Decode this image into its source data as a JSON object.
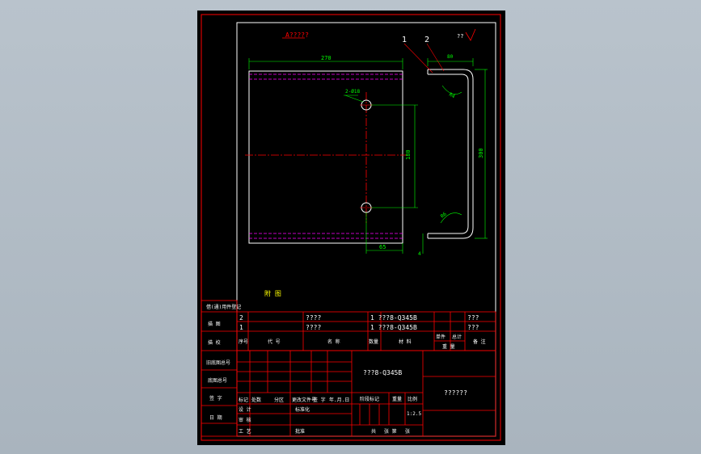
{
  "colors": {
    "background": "#b3bec8",
    "sheet": "#000000",
    "frame": "#ff0000",
    "line": "#ffffff",
    "dimension": "#00ff00",
    "center": "#ff0000",
    "hidden": "#ff00ff",
    "text_yellow": "#ffff00"
  },
  "drawing": {
    "view_label": "A?????",
    "roughness": "??",
    "balloon_1": "1",
    "balloon_2": "2",
    "dim_width": "270",
    "dim_depth": "80",
    "dim_height": "300",
    "dim_hole_spacing": "180",
    "dim_hole_edge": "65",
    "dim_thickness": "4",
    "dim_radius_top": "R4",
    "dim_radius_bottom": "R6",
    "hole_callout": "2-Ø18",
    "note": "附 图"
  },
  "bom": {
    "rows": [
      {
        "no": "2",
        "name": "????",
        "qty_mat": "1 ???8-Q345B",
        "extra": "???"
      },
      {
        "no": "1",
        "name": "????",
        "qty_mat": "1 ???8-Q345B",
        "extra": "???"
      }
    ],
    "header": {
      "seq": "序号",
      "code": "代  号",
      "name": "名  称",
      "qty": "数量",
      "material": "材  料",
      "single": "单件",
      "total": "总计",
      "weight": "重  量",
      "remark": "备 注"
    }
  },
  "left_column": {
    "row1": "借(通)用件登记",
    "row2": "旧底图总号",
    "row3": "底图总号",
    "row4": "签  字",
    "row5": "日  期",
    "top1": "描  图",
    "top2": "描  校"
  },
  "title_block": {
    "material": "???8-Q345B",
    "drawing_name": "??????",
    "mark": "标记",
    "count": "处数",
    "zone": "分区",
    "change_doc": "更改文件号",
    "sign": "签 字",
    "date": "年.月.日",
    "design": "设 计",
    "standard": "标准化",
    "stage_mark": "阶段标记",
    "weight": "重量",
    "scale": "比例",
    "check": "审 核",
    "process": "工 艺",
    "approve": "批准",
    "scale_value": "1:2.5",
    "sheets_total": "共",
    "sheet_no": "张 第",
    "sheet_end": "张"
  }
}
